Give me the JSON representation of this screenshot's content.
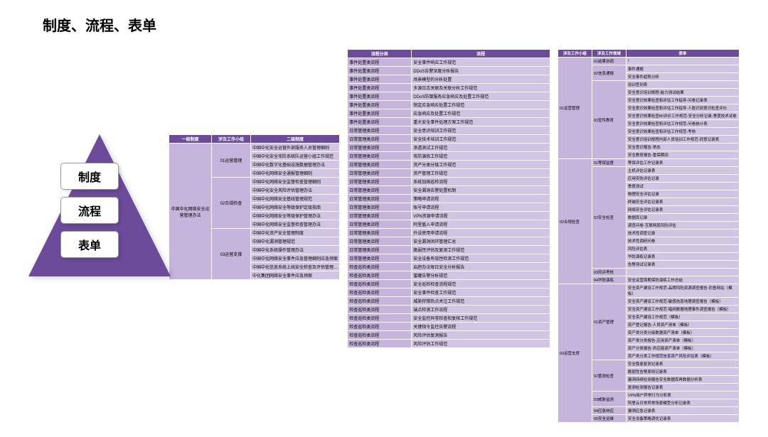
{
  "title": "制度、流程、表单",
  "pyramid": [
    "制度",
    "流程",
    "表单"
  ],
  "left_table": {
    "headers": [
      "一级制度",
      "涉及工作小组",
      "二级制度"
    ],
    "root": "中国中化网络安全运营管理办法",
    "groups": [
      {
        "code": "01运营管理",
        "rows": [
          "中国中化安全运营外部服务人员管理细则",
          "中国中化安全攻防系统队运营小组工作规范",
          "中国中化数字化基础设施数据管理办法",
          "中国中化网络安全通报管理细则"
        ]
      },
      {
        "code": "02合规检查",
        "rows": [
          "中国中化网络安全监督检查管理细则",
          "中国中化安全风险评估管理办法",
          "中国中化网络安全基线管理规范",
          "中国中化网络安全等级保护定级指南",
          "中国中化网络安全等级保护管理办法",
          "中国中化网络安全监督检查管理办法"
        ]
      },
      {
        "code": "03运营支撑",
        "rows": [
          "中国中化资产安全管理制度",
          "中国中化漏洞管理规范",
          "中国中化系统操作管理办法",
          "中国中化网络安全事件应急管理细则应急预案",
          "中国中化信息系统上线安全检查及评估管理办法",
          "中化集团网络安全事件应急预案"
        ]
      }
    ]
  },
  "center_table": {
    "headers": [
      "流程分类",
      "流程"
    ],
    "rows": [
      [
        "事件处置类流程",
        "安全事件响应工作规范"
      ],
      [
        "事件处置类流程",
        "DDoS告警深度分析报告"
      ],
      [
        "事件处置类流程",
        "场景模型的分析处置"
      ],
      [
        "事件处置类流程",
        "多源日志关联及关联分析工作规范"
      ],
      [
        "事件处置类流程",
        "DDoS防御服务应急响应及处置工作规范"
      ],
      [
        "事件处置类流程",
        "制定应急响应处置工作规范"
      ],
      [
        "事件处置类流程",
        "应急响应及处置工作规范"
      ],
      [
        "事件处置类流程",
        "重大安全事件处理方案工作规范"
      ],
      [
        "日常管理类流程",
        "安全意识培训工作规范"
      ],
      [
        "日常管理类流程",
        "安全技术培训工作规范"
      ],
      [
        "日常管理类流程",
        "渗透测试工作规范"
      ],
      [
        "日常管理类流程",
        "攻防演练工作规范"
      ],
      [
        "日常管理类流程",
        "资产分类分级工作规范"
      ],
      [
        "日常管理类流程",
        "资产管理工作规范"
      ],
      [
        "日常管理类流程",
        "系统加固巡检流程"
      ],
      [
        "日常管理类流程",
        "安全漏洞告警处置机制"
      ],
      [
        "日常管理类流程",
        "策略申请流程"
      ],
      [
        "日常管理类流程",
        "账号申请流程"
      ],
      [
        "日常管理类流程",
        "VPN资源申请流程"
      ],
      [
        "日常管理类流程",
        "阿里盾入申请流程"
      ],
      [
        "日常管理类流程",
        "外设使用申请流程"
      ],
      [
        "日常管理类流程",
        "安全漏洞闭环管理汇总"
      ],
      [
        "日常管理类流程",
        "脆弱性评估及复测工作规范"
      ],
      [
        "日常管理类流程",
        "安全设备有效性检测工作规范"
      ],
      [
        "检查巡检类流程",
        "启趋办法每日安全分析报告"
      ],
      [
        "检查巡检类流程",
        "蜜罐告警分析规范"
      ],
      [
        "检查巡检类流程",
        "安全巡检检查流程规范"
      ],
      [
        "检查巡检类流程",
        "安全事件检查工作规范"
      ],
      [
        "检查巡检类流程",
        "威胁狩猎热点关注工作规范"
      ],
      [
        "检查巡检类流程",
        "端点检测工作流程"
      ],
      [
        "检查巡检类流程",
        "安全监控异常检查和复核工作规范"
      ],
      [
        "检查巡检类流程",
        "关键指令监控告警流程"
      ],
      [
        "检查巡检类流程",
        "风险评估复测报告"
      ],
      [
        "检查巡检类流程",
        "风险评估工作规范"
      ]
    ]
  },
  "right_table": {
    "headers": [
      "涉及工作小组",
      "涉及工作领域",
      "表单"
    ],
    "sections": [
      {
        "g1": "01运营管理",
        "groups": [
          {
            "g2": "01结果协调",
            "rows": [
              "/"
            ]
          },
          {
            "g2": "02信息通报",
            "rows": [
              "事件通报",
              "安全事件趋势分析"
            ]
          },
          {
            "g2": "03宣传教育",
            "rows": [
              "培训签到表",
              "安全意识培训规程-能力测试结果",
              "安全意识效果检查和评估工作指导-问卷记录表",
              "安全意识效果检查和评估工作指导-人脸识别意识检查评价",
              "安全意识效果检查80评价工作规范-安全分析记录-季度技术试卷",
              "安全意识效果检查和评估工作规范-问卷统计表",
              "安全意识效果检查和评估工作规范-考核",
              "安全意识培训规程内部人员培训工作规范-同意记录表",
              "安全意识报告-常态",
              "安全教育报告-重保期间"
            ]
          }
        ]
      },
      {
        "g1": "02合规检查",
        "groups": [
          {
            "g2": "01等保监督",
            "rows": [
              "等保评估工作记录表"
            ]
          },
          {
            "g2": "02安全检查",
            "rows": [
              "主机评估记录表",
              "应用安防评估记录",
              "季度测试",
              "物理安全评估记录",
              "终端安全评估记录表",
              "网络安全评估记录表",
              "数据库记录",
              "调查问卷-互联网层风险评估",
              "技术性调查记录",
              "技术性调研问卷",
              "风险评估表",
              "华防演练记录表",
              "告警测试记录表"
            ]
          },
          {
            "g2": "03风评考核",
            "rows": [
              ""
            ]
          },
          {
            "g2": "04华防演练",
            "rows": [
              "安全运营周期保防演练工作总结"
            ]
          }
        ]
      },
      {
        "g1": "03运营支撑",
        "groups": [
          {
            "g2": "01资产管理",
            "rows": [
              "安全资产建设工作规范-品牌风险资源调查报告-钓鱼网站（模板）",
              "安全资产建设工作规范-敏感信息地理调查报告（模板）",
              "安全资产建设工作规范-暗网数据地理事件调查报告（模板）",
              "安全资产建设工作规范（模板）",
              "资产登记报告-人员资产清单（模板）",
              "资产类分类分级数据资产清单（模板）",
              "资产类分类报告-应用资产清单（模板）",
              "资产分类报告-供应链资产清单（模板）",
              "资产类分类工作规范信息资产风险评估表（模板）"
            ]
          },
          {
            "g2": "02置测检查",
            "rows": [
              "安全隐患复测记录表",
              "脆弱性告警原则记录表",
              "漏洞持续检测报告安全数据库再数据分析表",
              "复测检测报告记录表"
            ]
          },
          {
            "g2": "03威胁监测",
            "rows": [
              "VPN用户异常行为分析表",
              "阿里云日常异常场景模型分析记录表"
            ]
          },
          {
            "g2": "04应急响应",
            "rows": [
              "漏洞应急记录表"
            ]
          },
          {
            "g2": "05安全运维",
            "rows": [
              "安全设备策略调优记录表"
            ]
          }
        ]
      }
    ]
  }
}
